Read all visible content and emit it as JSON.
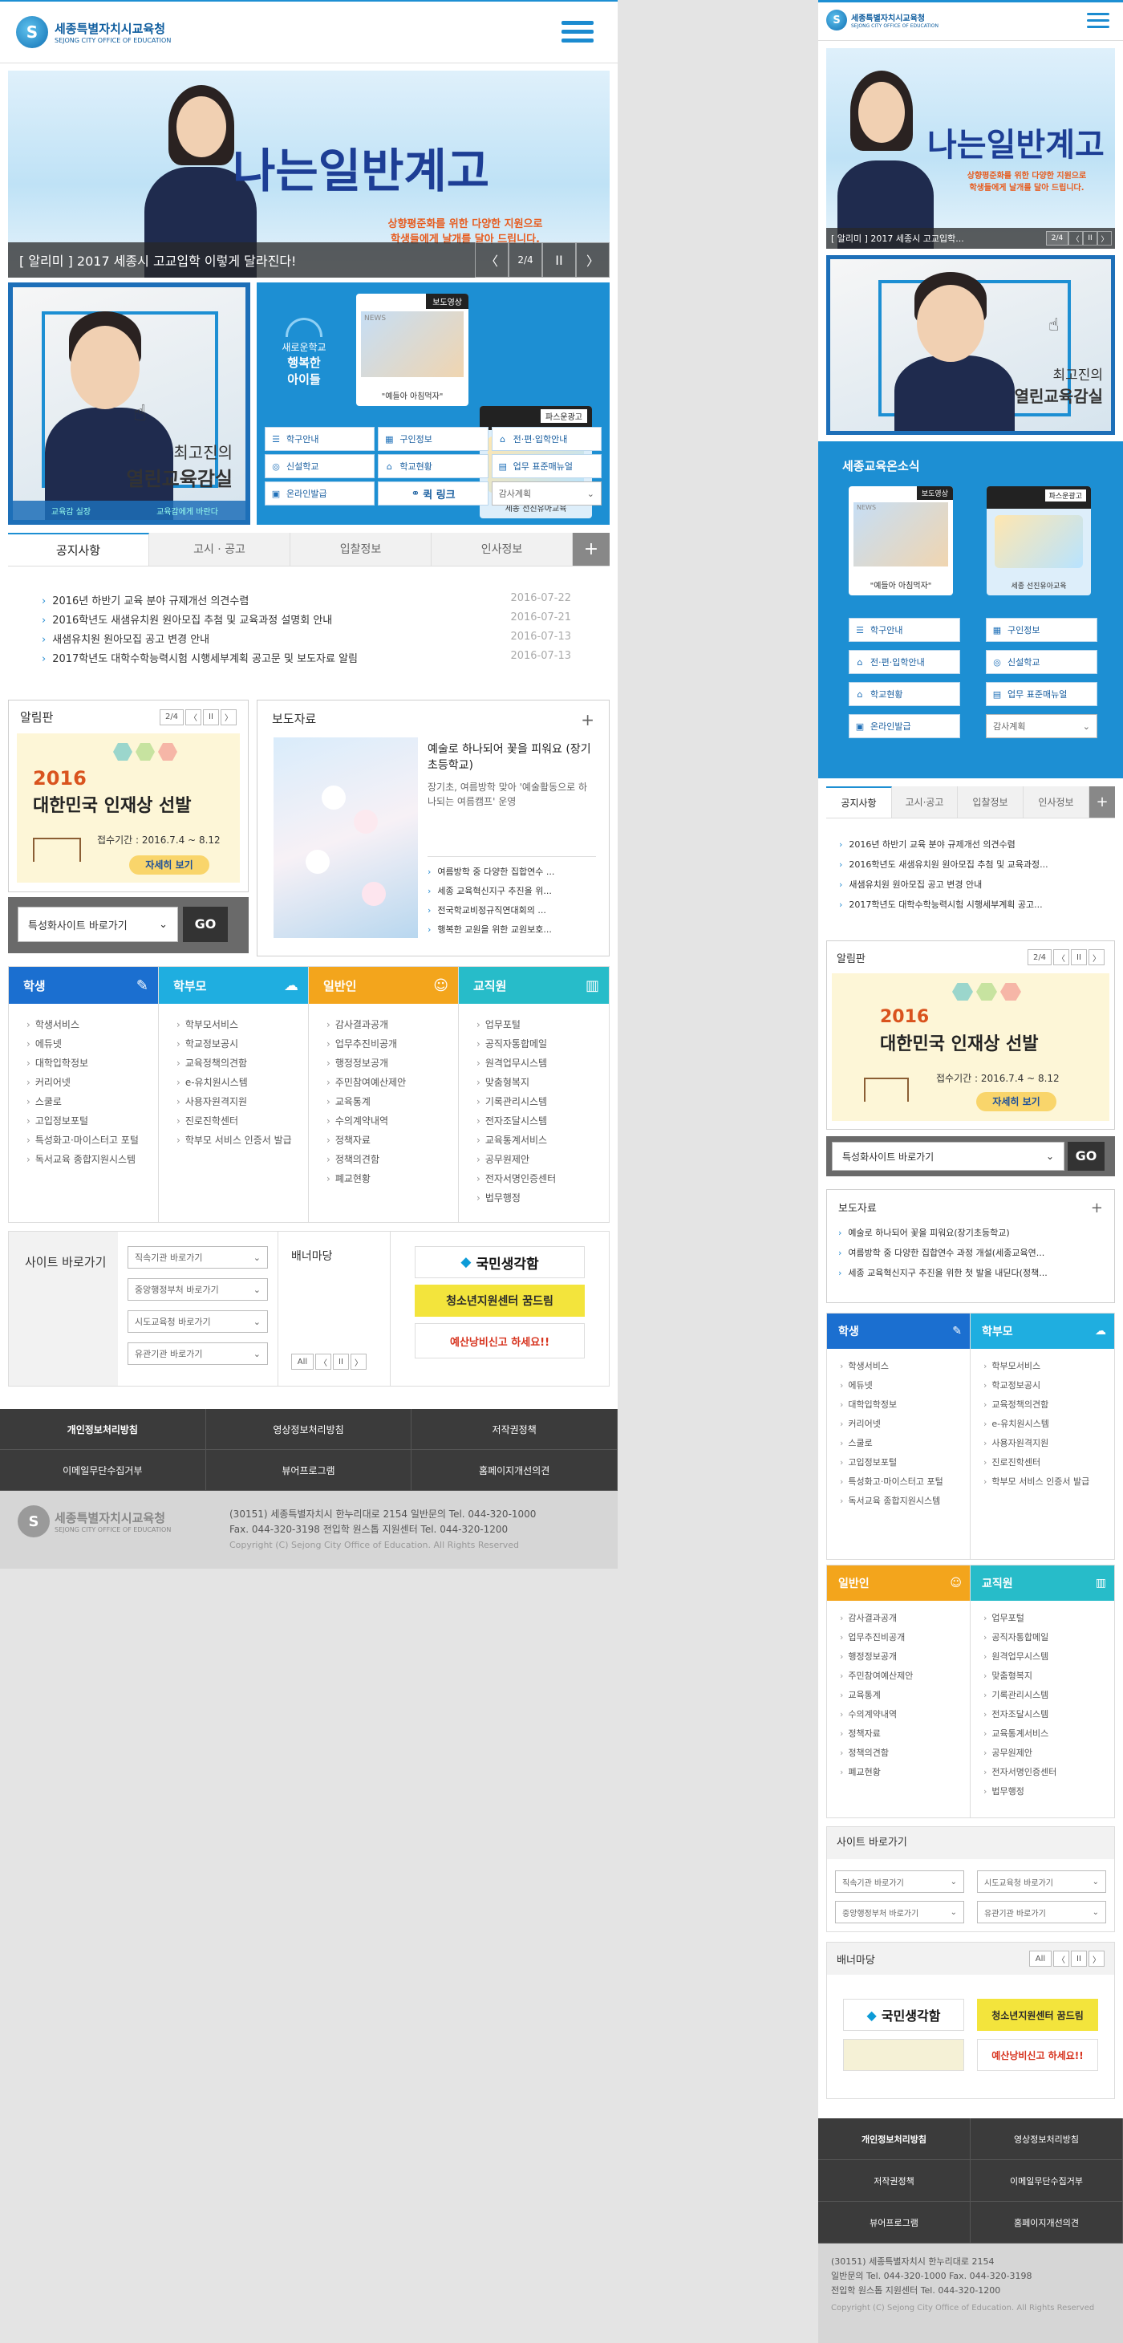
{
  "org": {
    "name": "세종특별자치시교육청",
    "name_en": "SEJONG CITY OFFICE OF EDUCATION",
    "logo_mark": "S"
  },
  "colors": {
    "primary": "#1d8fd3",
    "student": "#1b6fd0",
    "parent": "#1faee0",
    "general": "#f3a51c",
    "staff": "#27bcc9"
  },
  "hero": {
    "title": "나는일반계고",
    "sub1": "상향평준화를 위한 다양한 지원으로",
    "sub2": "학생들에게 날개를 달아 드립니다.",
    "caption_left": "[ 알리미 ] 2017 세종시 고교입학 이렇게 달라진다!",
    "caption_right": "[ 알리미 ] 2017 세종시 고교입학...",
    "counter": "2/4",
    "prev": "〈",
    "next": "〉",
    "pause": "II"
  },
  "promo": {
    "line1": "최고진의",
    "line2": "열린교육감실",
    "btn1": "교육감 실장",
    "btn2": "교육감에게 바란다"
  },
  "blue": {
    "title": "세종교육온소식",
    "happy1": "새로운학교",
    "happy2": "행복한",
    "happy3": "아이들",
    "card1_tag": "보도영상",
    "card1_cap": "\"예들아 아침먹자\"",
    "card1_news": "NEWS",
    "card2_tag": "파스운광고",
    "card2_cap": "세종 선진유아교육"
  },
  "quick": [
    {
      "icon": "☰",
      "label": "학구안내"
    },
    {
      "icon": "▦",
      "label": "구인정보"
    },
    {
      "icon": "⌂",
      "label": "전·편·입학안내"
    },
    {
      "icon": "◎",
      "label": "신설학교"
    },
    {
      "icon": "⌂",
      "label": "학교현황"
    },
    {
      "icon": "▤",
      "label": "업무 표준매뉴얼"
    },
    {
      "icon": "▣",
      "label": "온라인발급"
    }
  ],
  "quicklink": {
    "label": "퀵 링크",
    "select": "감사계획",
    "arrow": "⌄"
  },
  "tabs": [
    "공지사항",
    "고시 · 공고",
    "입찰정보",
    "인사정보"
  ],
  "tabs_r": [
    "공지사항",
    "고시·공고",
    "입찰정보",
    "인사정보"
  ],
  "plus": "+",
  "notices": [
    {
      "t": "2016년 하반기 교육 분야 규제개선 의견수렴",
      "d": "2016-07-22"
    },
    {
      "t": "2016학년도 새샘유치원 원아모집 추첨 및 교육과정 설명회 안내",
      "d": "2016-07-21"
    },
    {
      "t": "새샘유치원 원아모집 공고 변경 안내",
      "d": "2016-07-13"
    },
    {
      "t": "2017학년도 대학수학능력시험 시행세부계획 공고문 및 보도자료 알림",
      "d": "2016-07-13"
    }
  ],
  "notices_r": [
    "2016년 하반기 교육 분야 규제개선 의견수렴",
    "2016학년도 새샘유치원 원아모집 추첨 및 교육과정...",
    "새샘유치원 원아모집 공고 변경 안내",
    "2017학년도 대학수학능력시험 시행세부계획 공고..."
  ],
  "alarm": {
    "title": "알림판",
    "counter": "2/4",
    "year": "2016",
    "headline": "대한민국 인재상 선발",
    "period": "접수기간 : 2016.7.4 ~ 8.12",
    "btn": "자세히 보기"
  },
  "special": {
    "label": "특성화사이트 바로가기",
    "arrow": "⌄",
    "go": "GO"
  },
  "press": {
    "title": "보도자료",
    "feature_title": "예술로 하나되어 꽃을 피워요 (장기초등학교)",
    "feature_desc": "장기초, 여름방학 맞아 '예술활동으로 하나되는 여름캠프' 운영",
    "items": [
      "여름방학 중 다양한 집합연수 ...",
      "세종 교육혁신지구 추진을 위...",
      "전국학교비정규직연대회의 ...",
      "행복한 교원을 위한 교원보호..."
    ],
    "items_r": [
      "예술로 하나되어 꽃을 피워요(장기초등학교)",
      "여름방학 중 다양한 집합연수 과정 개설(세종교육연...",
      "세종 교육혁신지구 추진을 위한 첫 발을 내딛다(정책..."
    ]
  },
  "categories": [
    {
      "key": "student",
      "title": "학생",
      "items": [
        "학생서비스",
        "에듀넷",
        "대학입학정보",
        "커리어넷",
        "스쿨로",
        "고입정보포털",
        "특성화고·마이스터고 포털",
        "독서교육 종합지원시스템"
      ]
    },
    {
      "key": "parent",
      "title": "학부모",
      "items": [
        "학부모서비스",
        "학교정보공시",
        "교육정책의견함",
        "e-유치원시스템",
        "사용자원격지원",
        "진로진학센터",
        "학부모 서비스 인증서 발급"
      ]
    },
    {
      "key": "general",
      "title": "일반인",
      "items": [
        "감사결과공개",
        "업무추진비공개",
        "행정정보공개",
        "주민참여예산제안",
        "교육통계",
        "수의계약내역",
        "정책자료",
        "정책의견함",
        "폐교현황"
      ]
    },
    {
      "key": "staff",
      "title": "교직원",
      "items": [
        "업무포털",
        "공직자통합메일",
        "원격업무시스템",
        "맞춤형복지",
        "기록관리시스템",
        "전자조달시스템",
        "교육통계서비스",
        "공무원제안",
        "전자서명인증센터",
        "법무행정"
      ]
    }
  ],
  "sites": {
    "title": "사이트 바로가기",
    "selects": [
      "직속기관 바로가기",
      "중앙행정부처 바로가기",
      "시도교육청 바로가기",
      "유관기관 바로가기"
    ]
  },
  "banner": {
    "title": "배너마당",
    "all": "All",
    "b1": "국민생각함",
    "b2": "청소년지원센터 꿈드림",
    "b3": "예산낭비신고 하세요!!"
  },
  "footer": {
    "links": [
      "개인정보처리방침",
      "영상정보처리방침",
      "저작권정책",
      "이메일무단수집거부",
      "뷰어프로그램",
      "홈페이지개선의견"
    ],
    "addr1": "(30151) 세종특별자치시 한누리대로 2154   일반문의  Tel. 044-320-1000",
    "addr2": "Fax. 044-320-3198 전입학 원스톱 지원센터  Tel. 044-320-1200",
    "addr_r1": "(30151) 세종특별자치시 한누리대로 2154",
    "addr_r2": "일반문의 Tel. 044-320-1000  Fax. 044-320-3198",
    "addr_r3": "전입학 원스톱 지원센터  Tel. 044-320-1200",
    "copy": "Copyright (C) Sejong City Office of Education. All Rights Reserved"
  }
}
